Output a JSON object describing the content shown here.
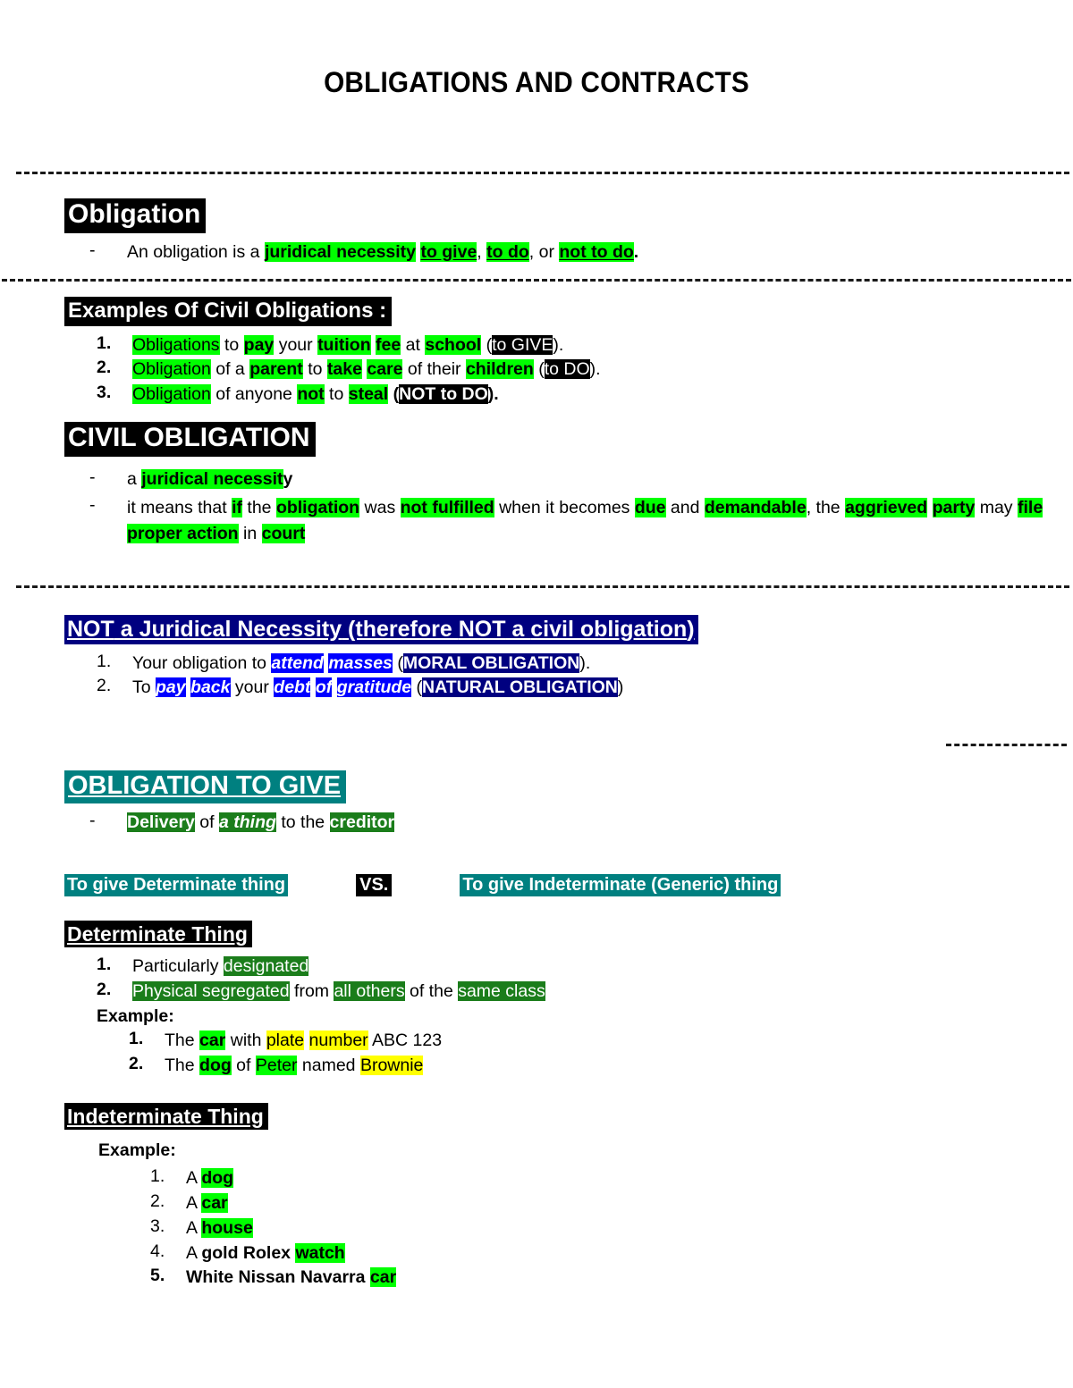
{
  "document": {
    "title": "OBLIGATIONS AND CONTRACTS"
  },
  "colors": {
    "green_highlight": "#00FF00",
    "black_highlight": "#000000",
    "dark_green_highlight": "#1B7D1B",
    "teal_highlight": "#008080",
    "blue_highlight": "#0000FF",
    "navy_highlight": "#000080",
    "yellow_highlight": "#FFFF00"
  },
  "section_obligation": {
    "heading": "Obligation",
    "bullet_mark": "-",
    "line": {
      "t1": "An obligation is a ",
      "h1": "juridical necessity",
      "t2": " ",
      "h2": "to give",
      "t3": ", ",
      "h3": "to do",
      "t4": ", or ",
      "h4": "not to do",
      "t5": "."
    }
  },
  "section_examples": {
    "heading": "Examples Of Civil Obligations :",
    "items": [
      {
        "num": "1.",
        "g1": "Obligations",
        "t1": " to ",
        "g2": "pay",
        "t2": " your ",
        "g3": "tuition",
        "t3": " ",
        "g4": "fee",
        "t4": " at ",
        "g5": "school",
        "t5": " (",
        "k1": "to GIVE",
        "t6": ")."
      },
      {
        "num": "2.",
        "g1": "Obligation",
        "t1": " of a ",
        "g2": "parent",
        "t2": " to ",
        "g3": "take",
        "t3": " ",
        "g4": "care",
        "t4": " of their ",
        "g5": "children",
        "t5": " (",
        "k1": "to DO",
        "t6": ")."
      },
      {
        "num": "3.",
        "g1": "Obligation",
        "t1": " of anyone ",
        "g2": "not",
        "t2": " to ",
        "g3": "steal",
        "t3": " (",
        "k1": "NOT to DO",
        "t4": ")."
      }
    ]
  },
  "section_civil": {
    "heading": "CIVIL OBLIGATION",
    "bullet_mark": "-",
    "line1": {
      "t1": "a ",
      "h1": "juridical necessit",
      "t2": "y"
    },
    "line2": {
      "t1": "it means that ",
      "h1": "if",
      "t2": " the ",
      "h2": "obligation",
      "t3": " was ",
      "h3": "not fulfilled",
      "t4": " when it becomes ",
      "h4": "due",
      "t5": " and ",
      "h5": "demandable",
      "t6": ", the ",
      "h6": "aggrieved",
      "t7": " ",
      "h7": "party",
      "t8": " may ",
      "h8": "file proper action",
      "t9": " in ",
      "h9": "court"
    }
  },
  "section_not_juridical": {
    "heading": {
      "p1": "NOT",
      "p2": " a ",
      "p3": "Juridical Necessity",
      "p4": " (therefore ",
      "p5": "NOT",
      "p6": " a ",
      "p7": "civil obligation",
      "p8": ")"
    },
    "items": [
      {
        "num": "1.",
        "t1": "Your obligation to ",
        "b1": "attend",
        "t2": " ",
        "b2": "masses",
        "t3": " (",
        "n1": "MORAL OBLIGATION",
        "t4": ")."
      },
      {
        "num": "2.",
        "t1": "To ",
        "b1": "pay",
        "t2": " ",
        "b2": "back",
        "t3": " your ",
        "b3": "debt",
        "t4": " ",
        "b4": "of",
        "t5": " ",
        "b5": "gratitude",
        "t6": " (",
        "n1": "NATURAL OBLIGATION",
        "t7": ")"
      }
    ]
  },
  "section_obligation_to_give": {
    "heading": "OBLIGATION TO GIVE",
    "bullet_mark": "-",
    "line": {
      "h1": "Delivery",
      "t1": " of ",
      "h2": "a thing",
      "t2": " to the ",
      "h3": "creditor"
    },
    "comparison": {
      "left": "To give Determinate thing",
      "middle": "VS.",
      "right": "To give Indeterminate (Generic) thing"
    }
  },
  "section_determinate": {
    "heading": "Determinate Thing",
    "items": [
      {
        "num": "1.",
        "t1": "Particularly ",
        "h1": "designated"
      },
      {
        "num": "2.",
        "h1": "Physical segregated",
        "t1": " from ",
        "h2": "all others",
        "t2": " of the ",
        "h3": "same class"
      }
    ],
    "example_label": "Example:",
    "examples": [
      {
        "num": "1.",
        "t1": "The ",
        "g1": "car",
        "t2": " with ",
        "y1": "plate",
        "t3": " ",
        "y2": "number",
        "t4": " ABC 123"
      },
      {
        "num": "2.",
        "t1": "The ",
        "g1": "dog",
        "t2": " of ",
        "g2": "Peter",
        "t3": " named ",
        "y1": "Brownie"
      }
    ]
  },
  "section_indeterminate": {
    "heading": "Indeterminate Thing",
    "example_label": "Example:",
    "examples": [
      {
        "num": "1.",
        "t1": "A ",
        "g1": "dog"
      },
      {
        "num": "2.",
        "t1": "A ",
        "g1": "car"
      },
      {
        "num": "3.",
        "t1": "A ",
        "g1": "house"
      },
      {
        "num": "4.",
        "t1": "A ",
        "b1": "gold Rolex ",
        "g1": "watch"
      },
      {
        "num": "5.",
        "b1": "White Nissan Navarra ",
        "g1": "car"
      }
    ]
  }
}
